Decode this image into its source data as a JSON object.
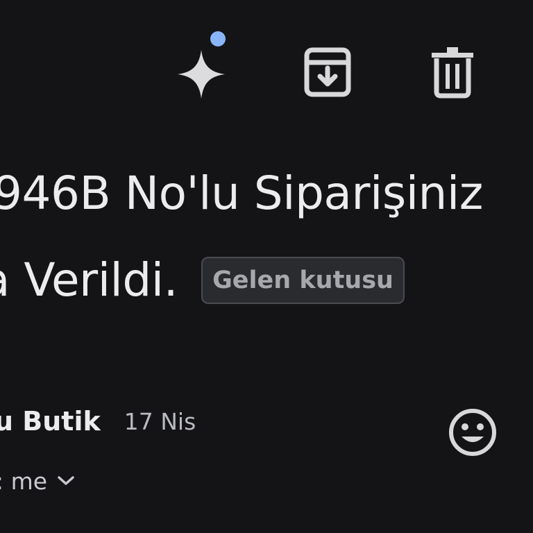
{
  "toolbar": {
    "sparkle_icon": "sparkle-icon",
    "archive_icon": "archive-icon",
    "delete_icon": "trash-icon",
    "notification_dot_color": "#8ab4f8"
  },
  "email": {
    "subject_line1": "946B No'lu Siparişiniz",
    "subject_line2": "a Verildi.",
    "label": "Gelen kutusu",
    "sender": "u Butik",
    "date": "17 Nis",
    "recipient": ": me",
    "emoji_icon": "smiley-icon"
  },
  "colors": {
    "background": "#141416",
    "text": "#ececee",
    "chip_background": "#2a2b2f",
    "chip_border": "#4a4c52"
  }
}
